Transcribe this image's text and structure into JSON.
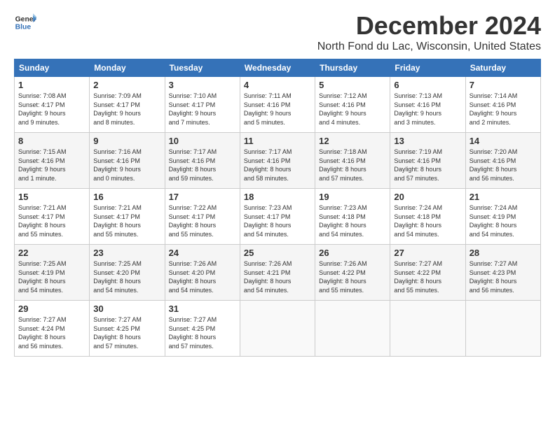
{
  "logo": {
    "line1": "General",
    "line2": "Blue"
  },
  "title": "December 2024",
  "location": "North Fond du Lac, Wisconsin, United States",
  "headers": [
    "Sunday",
    "Monday",
    "Tuesday",
    "Wednesday",
    "Thursday",
    "Friday",
    "Saturday"
  ],
  "weeks": [
    [
      {
        "day": "1",
        "info": "Sunrise: 7:08 AM\nSunset: 4:17 PM\nDaylight: 9 hours\nand 9 minutes."
      },
      {
        "day": "2",
        "info": "Sunrise: 7:09 AM\nSunset: 4:17 PM\nDaylight: 9 hours\nand 8 minutes."
      },
      {
        "day": "3",
        "info": "Sunrise: 7:10 AM\nSunset: 4:17 PM\nDaylight: 9 hours\nand 7 minutes."
      },
      {
        "day": "4",
        "info": "Sunrise: 7:11 AM\nSunset: 4:16 PM\nDaylight: 9 hours\nand 5 minutes."
      },
      {
        "day": "5",
        "info": "Sunrise: 7:12 AM\nSunset: 4:16 PM\nDaylight: 9 hours\nand 4 minutes."
      },
      {
        "day": "6",
        "info": "Sunrise: 7:13 AM\nSunset: 4:16 PM\nDaylight: 9 hours\nand 3 minutes."
      },
      {
        "day": "7",
        "info": "Sunrise: 7:14 AM\nSunset: 4:16 PM\nDaylight: 9 hours\nand 2 minutes."
      }
    ],
    [
      {
        "day": "8",
        "info": "Sunrise: 7:15 AM\nSunset: 4:16 PM\nDaylight: 9 hours\nand 1 minute."
      },
      {
        "day": "9",
        "info": "Sunrise: 7:16 AM\nSunset: 4:16 PM\nDaylight: 9 hours\nand 0 minutes."
      },
      {
        "day": "10",
        "info": "Sunrise: 7:17 AM\nSunset: 4:16 PM\nDaylight: 8 hours\nand 59 minutes."
      },
      {
        "day": "11",
        "info": "Sunrise: 7:17 AM\nSunset: 4:16 PM\nDaylight: 8 hours\nand 58 minutes."
      },
      {
        "day": "12",
        "info": "Sunrise: 7:18 AM\nSunset: 4:16 PM\nDaylight: 8 hours\nand 57 minutes."
      },
      {
        "day": "13",
        "info": "Sunrise: 7:19 AM\nSunset: 4:16 PM\nDaylight: 8 hours\nand 57 minutes."
      },
      {
        "day": "14",
        "info": "Sunrise: 7:20 AM\nSunset: 4:16 PM\nDaylight: 8 hours\nand 56 minutes."
      }
    ],
    [
      {
        "day": "15",
        "info": "Sunrise: 7:21 AM\nSunset: 4:17 PM\nDaylight: 8 hours\nand 55 minutes."
      },
      {
        "day": "16",
        "info": "Sunrise: 7:21 AM\nSunset: 4:17 PM\nDaylight: 8 hours\nand 55 minutes."
      },
      {
        "day": "17",
        "info": "Sunrise: 7:22 AM\nSunset: 4:17 PM\nDaylight: 8 hours\nand 55 minutes."
      },
      {
        "day": "18",
        "info": "Sunrise: 7:23 AM\nSunset: 4:17 PM\nDaylight: 8 hours\nand 54 minutes."
      },
      {
        "day": "19",
        "info": "Sunrise: 7:23 AM\nSunset: 4:18 PM\nDaylight: 8 hours\nand 54 minutes."
      },
      {
        "day": "20",
        "info": "Sunrise: 7:24 AM\nSunset: 4:18 PM\nDaylight: 8 hours\nand 54 minutes."
      },
      {
        "day": "21",
        "info": "Sunrise: 7:24 AM\nSunset: 4:19 PM\nDaylight: 8 hours\nand 54 minutes."
      }
    ],
    [
      {
        "day": "22",
        "info": "Sunrise: 7:25 AM\nSunset: 4:19 PM\nDaylight: 8 hours\nand 54 minutes."
      },
      {
        "day": "23",
        "info": "Sunrise: 7:25 AM\nSunset: 4:20 PM\nDaylight: 8 hours\nand 54 minutes."
      },
      {
        "day": "24",
        "info": "Sunrise: 7:26 AM\nSunset: 4:20 PM\nDaylight: 8 hours\nand 54 minutes."
      },
      {
        "day": "25",
        "info": "Sunrise: 7:26 AM\nSunset: 4:21 PM\nDaylight: 8 hours\nand 54 minutes."
      },
      {
        "day": "26",
        "info": "Sunrise: 7:26 AM\nSunset: 4:22 PM\nDaylight: 8 hours\nand 55 minutes."
      },
      {
        "day": "27",
        "info": "Sunrise: 7:27 AM\nSunset: 4:22 PM\nDaylight: 8 hours\nand 55 minutes."
      },
      {
        "day": "28",
        "info": "Sunrise: 7:27 AM\nSunset: 4:23 PM\nDaylight: 8 hours\nand 56 minutes."
      }
    ],
    [
      {
        "day": "29",
        "info": "Sunrise: 7:27 AM\nSunset: 4:24 PM\nDaylight: 8 hours\nand 56 minutes."
      },
      {
        "day": "30",
        "info": "Sunrise: 7:27 AM\nSunset: 4:25 PM\nDaylight: 8 hours\nand 57 minutes."
      },
      {
        "day": "31",
        "info": "Sunrise: 7:27 AM\nSunset: 4:25 PM\nDaylight: 8 hours\nand 57 minutes."
      },
      {
        "day": "",
        "info": ""
      },
      {
        "day": "",
        "info": ""
      },
      {
        "day": "",
        "info": ""
      },
      {
        "day": "",
        "info": ""
      }
    ]
  ]
}
